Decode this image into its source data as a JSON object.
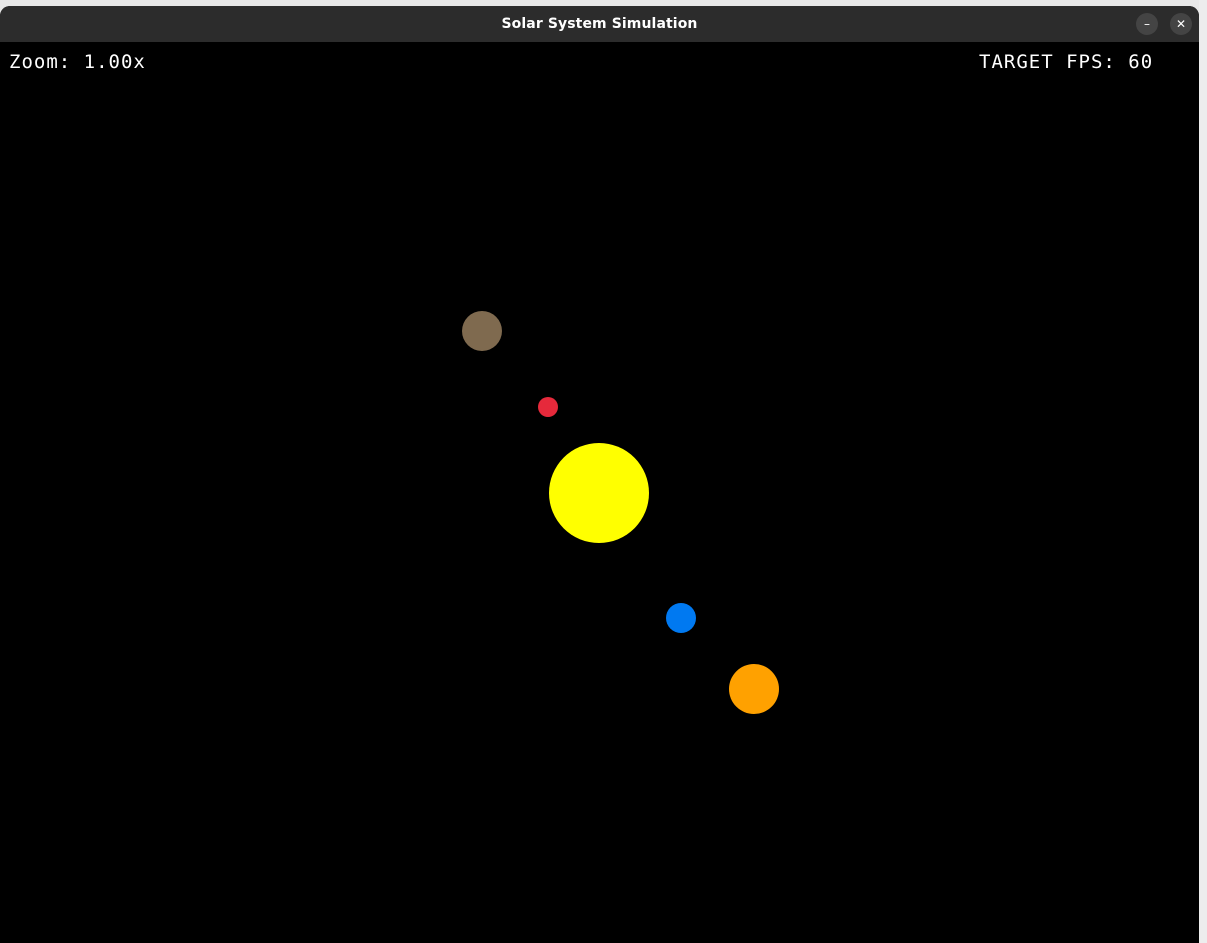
{
  "window": {
    "title": "Solar System Simulation",
    "minimize_icon": "–",
    "close_icon": "✕"
  },
  "hud": {
    "zoom_text": "Zoom: 1.00x",
    "fps_text": "TARGET FPS: 60"
  },
  "bodies": [
    {
      "name": "sun",
      "color": "#ffff00"
    },
    {
      "name": "planet-brown",
      "color": "#7f6a4f"
    },
    {
      "name": "planet-red",
      "color": "#e6293b"
    },
    {
      "name": "planet-blue",
      "color": "#0079f1"
    },
    {
      "name": "planet-orange",
      "color": "#ffa100"
    }
  ]
}
